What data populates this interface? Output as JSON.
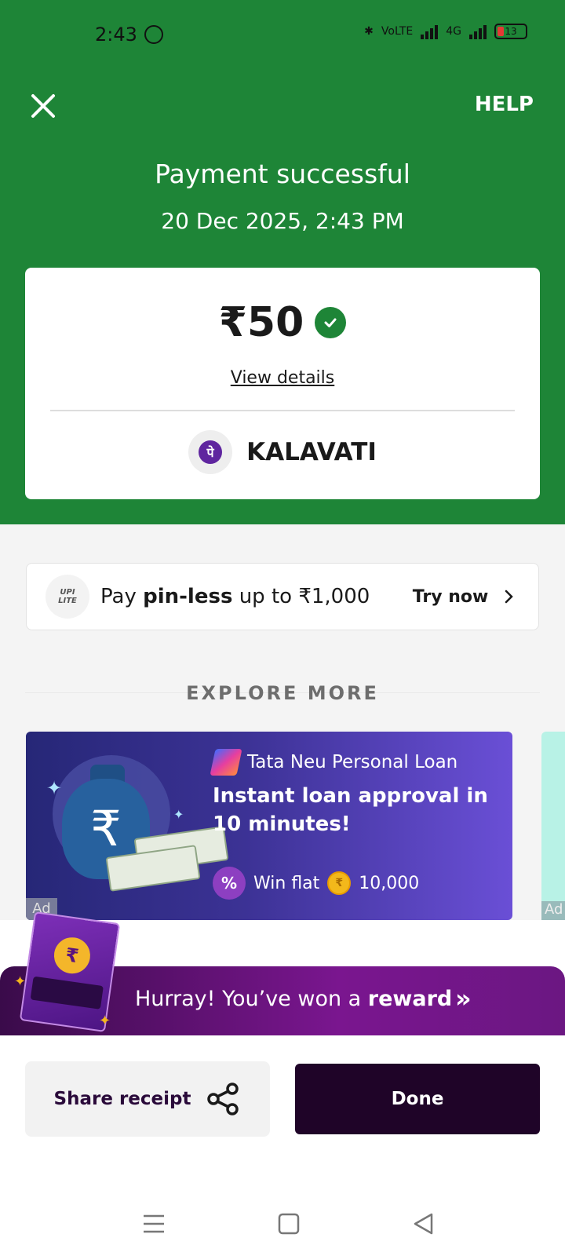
{
  "status_bar": {
    "time": "2:43",
    "network_label": "VoLTE",
    "network_type": "4G",
    "battery": "13"
  },
  "header": {
    "help_label": "HELP",
    "title": "Payment successful",
    "datetime": "20 Dec 2025, 2:43 PM"
  },
  "payment": {
    "amount": "₹50",
    "view_details": "View details",
    "merchant_name": "KALAVATI",
    "merchant_logo_glyph": "पे"
  },
  "upi_lite": {
    "logo_text": "UPI",
    "logo_sub": "LITE",
    "text_prefix": "Pay ",
    "text_bold": "pin-less",
    "text_suffix": " up to ₹1,000",
    "cta": "Try now"
  },
  "explore": {
    "heading": "EXPLORE MORE"
  },
  "ad": {
    "tag": "Ad",
    "brand": "Tata Neu Personal Loan",
    "headline": "Instant loan approval in 10 minutes!",
    "win_prefix": "Win flat",
    "win_amount": "10,000",
    "badge_glyph": "%",
    "peek_tag": "Ad"
  },
  "reward_banner": {
    "text_prefix": "Hurray! You’ve won a ",
    "text_bold": "reward",
    "arrow": "»"
  },
  "actions": {
    "share_label": "Share receipt",
    "done_label": "Done"
  },
  "colors": {
    "success_green": "#1e8537",
    "done_bg": "#1f0428",
    "reward_purple": "#7a168f"
  },
  "icons": [
    "close-icon",
    "check-icon",
    "share-icon",
    "chevron-right-icon",
    "double-chevron-icon",
    "menu-icon",
    "home-icon",
    "back-icon"
  ]
}
